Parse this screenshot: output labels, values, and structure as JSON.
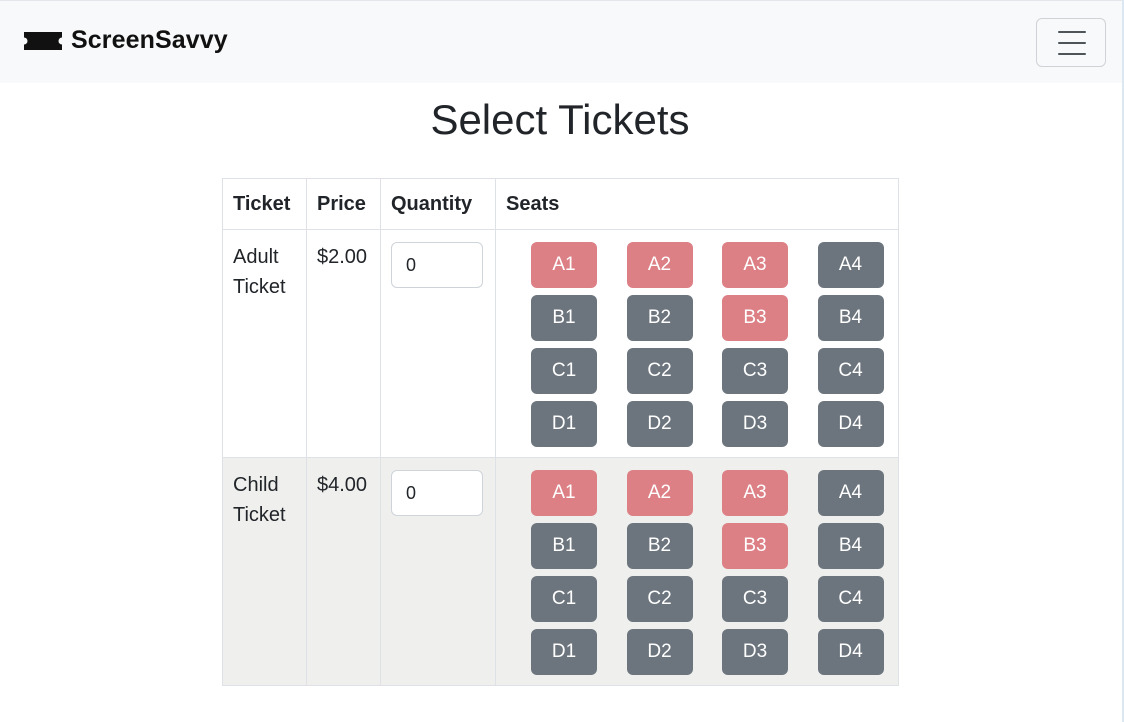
{
  "navbar": {
    "brand": "ScreenSavvy",
    "brand_icon": "ticket-icon",
    "toggler_icon": "hamburger-menu-icon"
  },
  "page_title": "Select Tickets",
  "table": {
    "headers": [
      "Ticket",
      "Price",
      "Quantity",
      "Seats"
    ],
    "rows": [
      {
        "ticket_line1": "Adult",
        "ticket_line2": "Ticket",
        "price": "$2.00",
        "quantity": "0",
        "seats": [
          {
            "label": "A1",
            "status": "taken"
          },
          {
            "label": "A2",
            "status": "taken"
          },
          {
            "label": "A3",
            "status": "taken"
          },
          {
            "label": "A4",
            "status": "available"
          },
          {
            "label": "B1",
            "status": "available"
          },
          {
            "label": "B2",
            "status": "available"
          },
          {
            "label": "B3",
            "status": "taken"
          },
          {
            "label": "B4",
            "status": "available"
          },
          {
            "label": "C1",
            "status": "available"
          },
          {
            "label": "C2",
            "status": "available"
          },
          {
            "label": "C3",
            "status": "available"
          },
          {
            "label": "C4",
            "status": "available"
          },
          {
            "label": "D1",
            "status": "available"
          },
          {
            "label": "D2",
            "status": "available"
          },
          {
            "label": "D3",
            "status": "available"
          },
          {
            "label": "D4",
            "status": "available"
          }
        ]
      },
      {
        "ticket_line1": "Child",
        "ticket_line2": "Ticket",
        "price": "$4.00",
        "quantity": "0",
        "seats": [
          {
            "label": "A1",
            "status": "taken"
          },
          {
            "label": "A2",
            "status": "taken"
          },
          {
            "label": "A3",
            "status": "taken"
          },
          {
            "label": "A4",
            "status": "available"
          },
          {
            "label": "B1",
            "status": "available"
          },
          {
            "label": "B2",
            "status": "available"
          },
          {
            "label": "B3",
            "status": "taken"
          },
          {
            "label": "B4",
            "status": "available"
          },
          {
            "label": "C1",
            "status": "available"
          },
          {
            "label": "C2",
            "status": "available"
          },
          {
            "label": "C3",
            "status": "available"
          },
          {
            "label": "C4",
            "status": "available"
          },
          {
            "label": "D1",
            "status": "available"
          },
          {
            "label": "D2",
            "status": "available"
          },
          {
            "label": "D3",
            "status": "available"
          },
          {
            "label": "D4",
            "status": "available"
          }
        ]
      }
    ]
  },
  "colors": {
    "seat_taken": "#dc8086",
    "seat_available": "#6c757d",
    "navbar_bg": "#f8f9fa",
    "shaded_row": "#efefed"
  }
}
